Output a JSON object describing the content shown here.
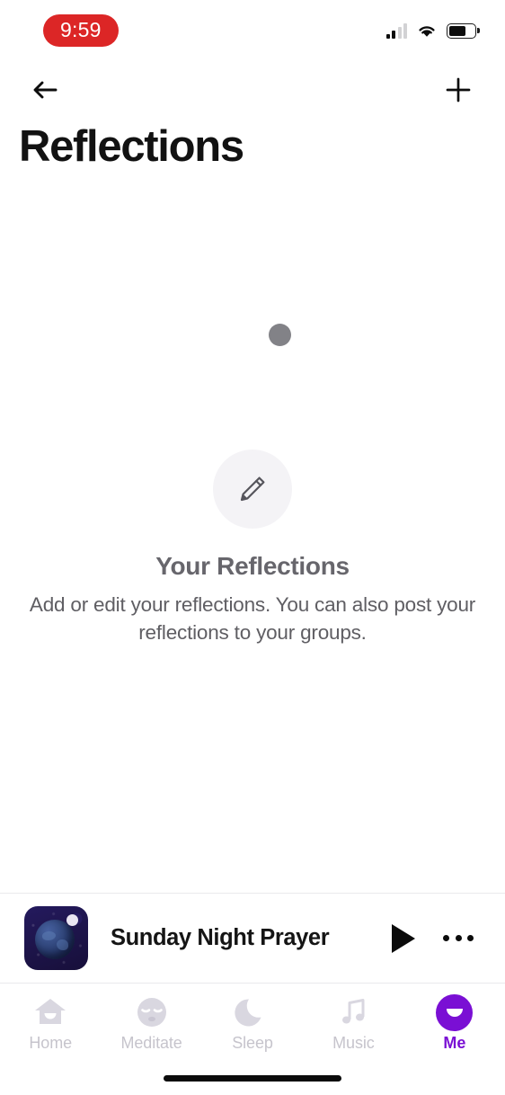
{
  "status_bar": {
    "time": "9:59",
    "time_pill_color": "#dc2626",
    "signal_icon": "cellular-signal-icon",
    "wifi_icon": "wifi-icon",
    "battery_icon": "battery-icon",
    "battery_level_percent": 65
  },
  "nav_bar": {
    "back_icon": "back-arrow-icon",
    "add_icon": "plus-icon"
  },
  "header": {
    "title": "Reflections"
  },
  "content": {
    "loading_indicator": "loading-dot",
    "empty_state": {
      "icon": "pencil-edit-icon",
      "title": "Your Reflections",
      "description": "Add or edit your reflections. You can also post your reflections to your groups."
    }
  },
  "mini_player": {
    "artwork_alt": "night-sky-earth-moon-artwork",
    "track_title": "Sunday Night Prayer",
    "play_icon": "play-icon",
    "more_icon": "more-options-icon"
  },
  "tab_bar": {
    "active_color": "#7a0fd4",
    "inactive_color": "#c6c4cc",
    "tabs": [
      {
        "label": "Home",
        "icon": "home-icon",
        "active": false
      },
      {
        "label": "Meditate",
        "icon": "meditate-face-icon",
        "active": false
      },
      {
        "label": "Sleep",
        "icon": "moon-icon",
        "active": false
      },
      {
        "label": "Music",
        "icon": "music-note-icon",
        "active": false
      },
      {
        "label": "Me",
        "icon": "profile-smile-icon",
        "active": true
      }
    ]
  },
  "system": {
    "home_indicator": "home-indicator"
  }
}
